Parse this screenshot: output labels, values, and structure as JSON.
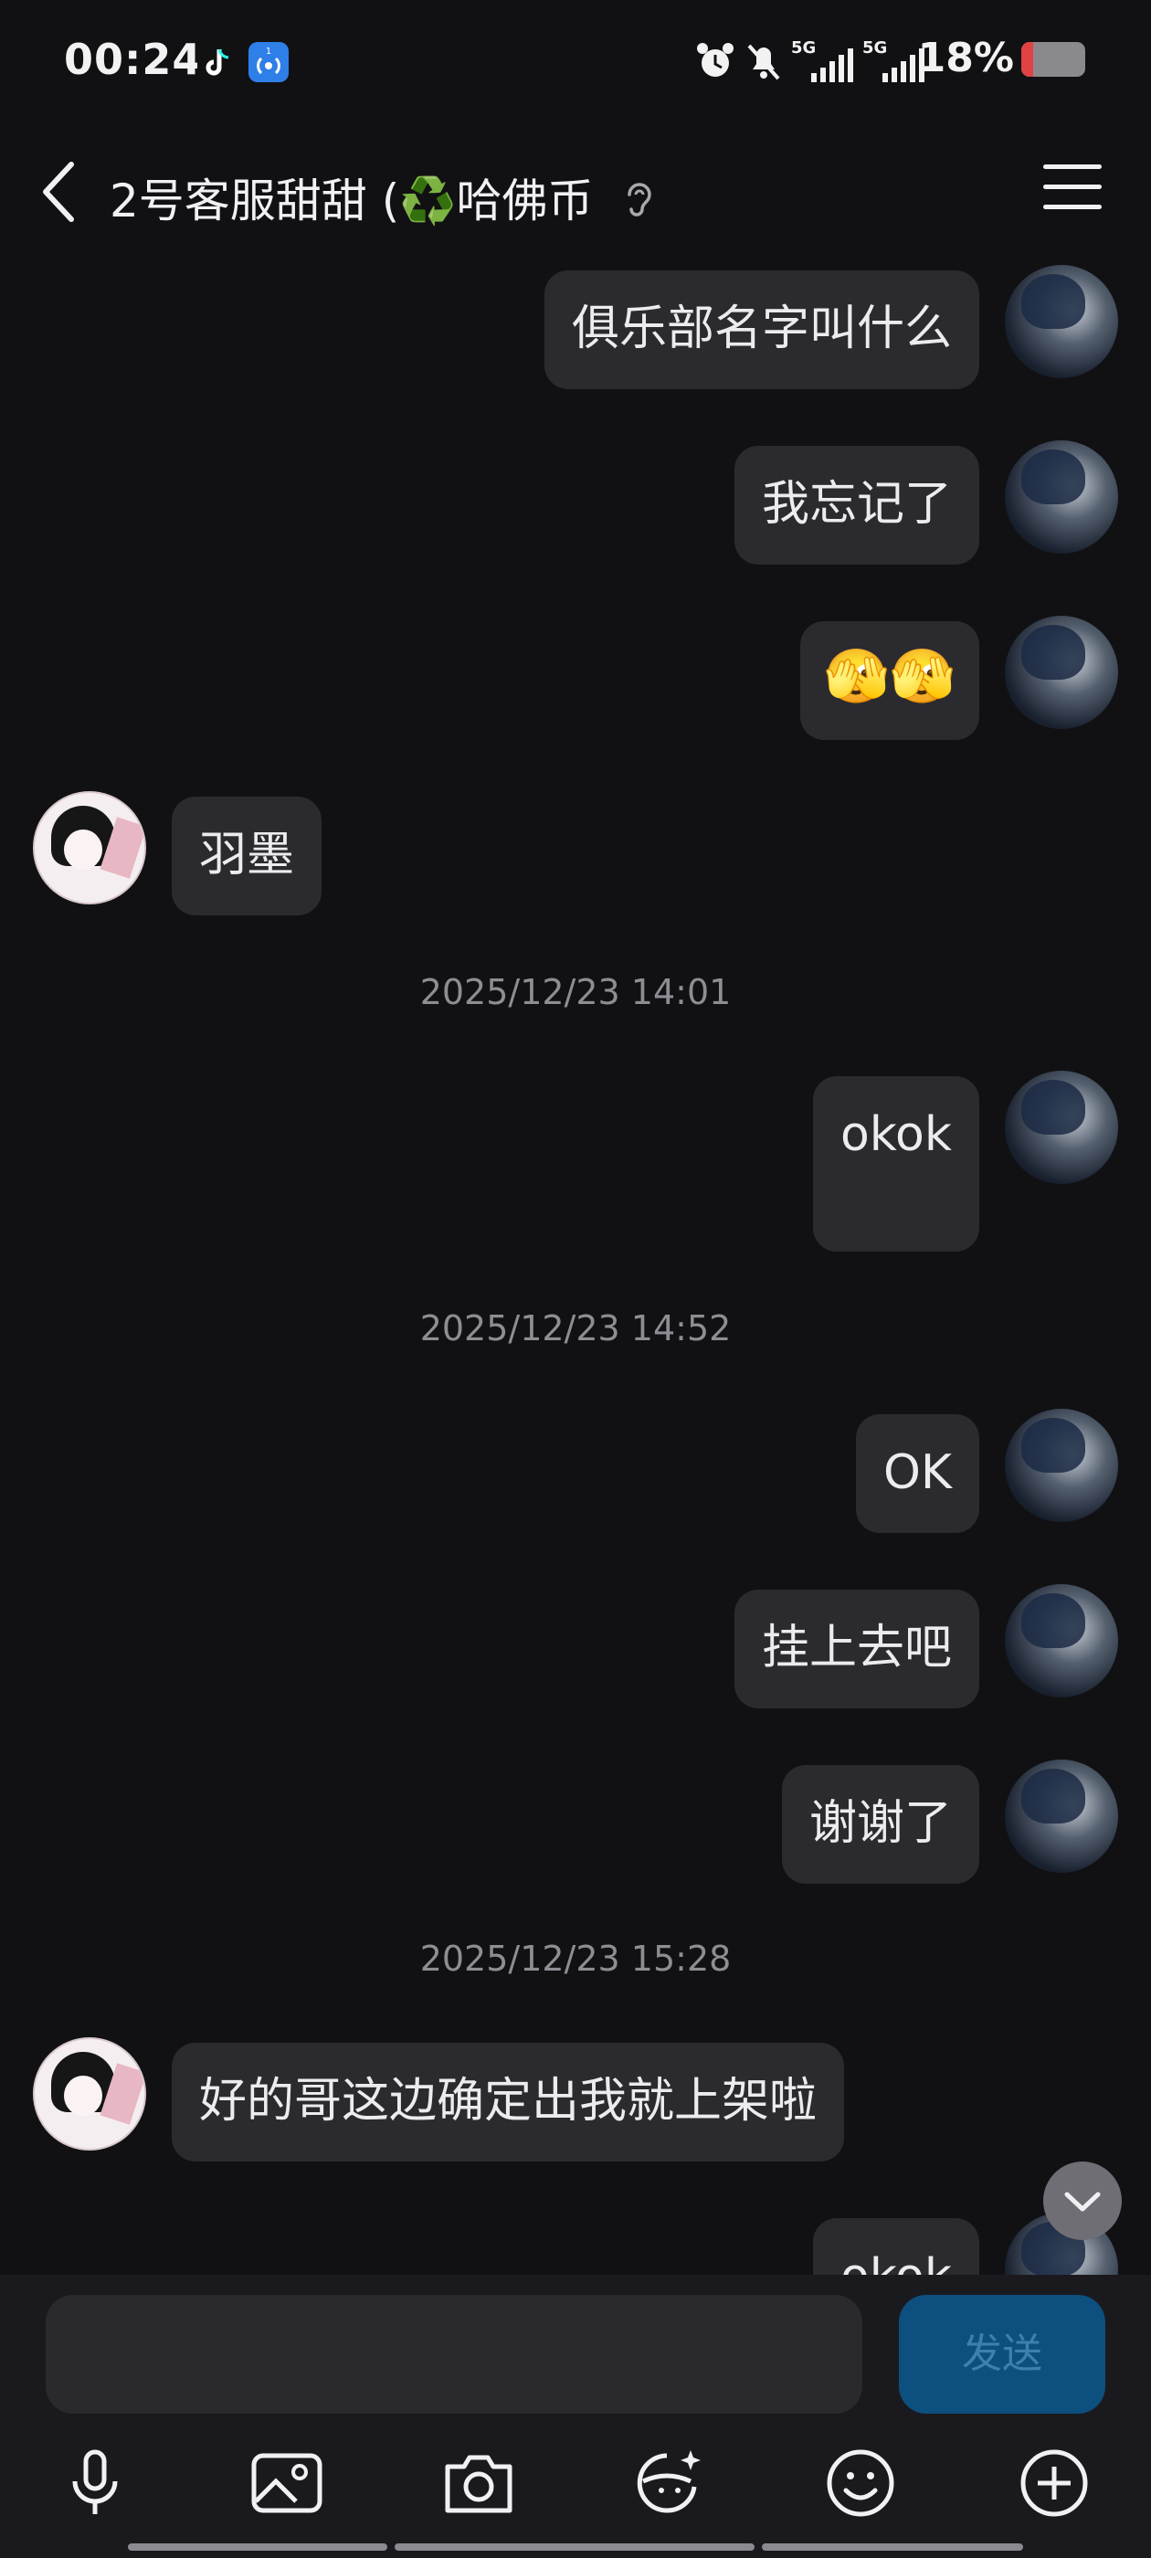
{
  "status_bar": {
    "time": "00:24",
    "battery_percent_text": "18%",
    "battery_level": 0.18,
    "network_1": "5G",
    "network_2": "5G",
    "icons": [
      "tiktok-icon",
      "hotspot-icon",
      "alarm-icon",
      "mute-icon",
      "signal-icon",
      "signal-icon",
      "battery-icon"
    ]
  },
  "header": {
    "title": "2号客服甜甜 (♻️哈佛币",
    "icons": [
      "back-icon",
      "ear-icon",
      "menu-icon"
    ]
  },
  "messages": [
    {
      "side": "right",
      "type": "text",
      "text": "俱乐部名字叫什么"
    },
    {
      "side": "right",
      "type": "text",
      "text": "我忘记了"
    },
    {
      "side": "right",
      "type": "emoji",
      "text": "🫣🫣"
    },
    {
      "side": "left",
      "type": "text",
      "text": "羽墨"
    },
    {
      "type": "timestamp",
      "text": "2025/12/23 14:01"
    },
    {
      "side": "right",
      "type": "text",
      "text": "okok"
    },
    {
      "type": "timestamp",
      "text": "2025/12/23 14:52"
    },
    {
      "side": "right",
      "type": "text",
      "text": "OK"
    },
    {
      "side": "right",
      "type": "text",
      "text": "挂上去吧"
    },
    {
      "side": "right",
      "type": "text",
      "text": "谢谢了"
    },
    {
      "type": "timestamp",
      "text": "2025/12/23 15:28"
    },
    {
      "side": "left",
      "type": "text",
      "text": "好的哥这边确定出我就上架啦"
    },
    {
      "side": "right",
      "type": "text",
      "text": "okok"
    }
  ],
  "input": {
    "value": "",
    "placeholder": "",
    "send_label": "发送"
  },
  "toolbar": [
    "microphone-icon",
    "image-icon",
    "camera-icon",
    "sticker-icon",
    "emoji-icon",
    "add-icon"
  ],
  "colors": {
    "background": "#111114",
    "bubble": "#2b2b2f",
    "send_button": "#0d4f7e",
    "battery_low": "#e04343"
  }
}
